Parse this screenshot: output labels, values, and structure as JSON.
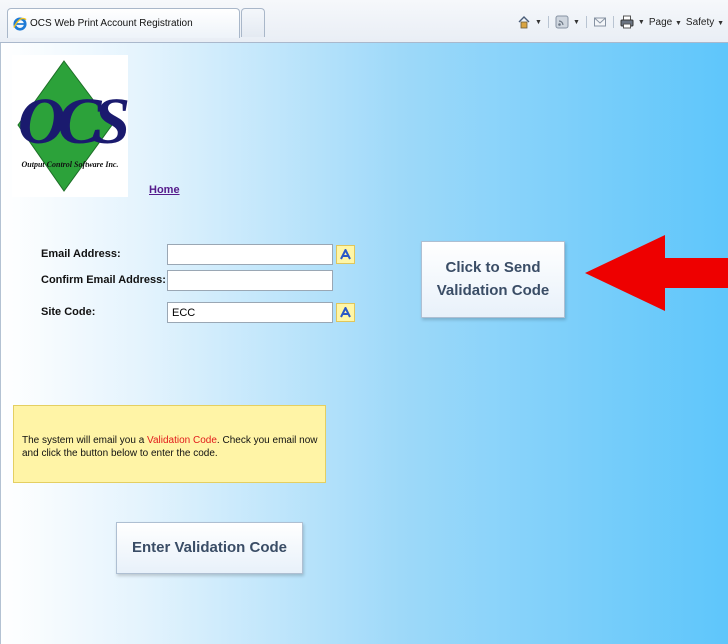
{
  "browser": {
    "tab_title": "OCS Web Print Account Registration",
    "command_bar": {
      "page_label": "Page",
      "safety_label": "Safety"
    }
  },
  "logo": {
    "letters": "OCS",
    "company": "Output Control Software Inc."
  },
  "nav": {
    "home_link": "Home"
  },
  "form": {
    "email_label": "Email Address:",
    "email_value": "",
    "confirm_label": "Confirm Email Address:",
    "confirm_value": "",
    "site_code_label": "Site Code:",
    "site_code_value": "ECC"
  },
  "buttons": {
    "send_line1": "Click to Send",
    "send_line2": "Validation Code",
    "enter_code": "Enter Validation Code"
  },
  "notice": {
    "part1": "The system will email you a ",
    "highlight": "Validation Code",
    "part2": ". Check you email now and click the button below to enter the code."
  },
  "colors": {
    "arrow": "#ee0000",
    "notice_bg": "#fff4a6",
    "highlight_text": "#e11b1b",
    "button_text": "#3a4d66",
    "link": "#551a8b"
  }
}
